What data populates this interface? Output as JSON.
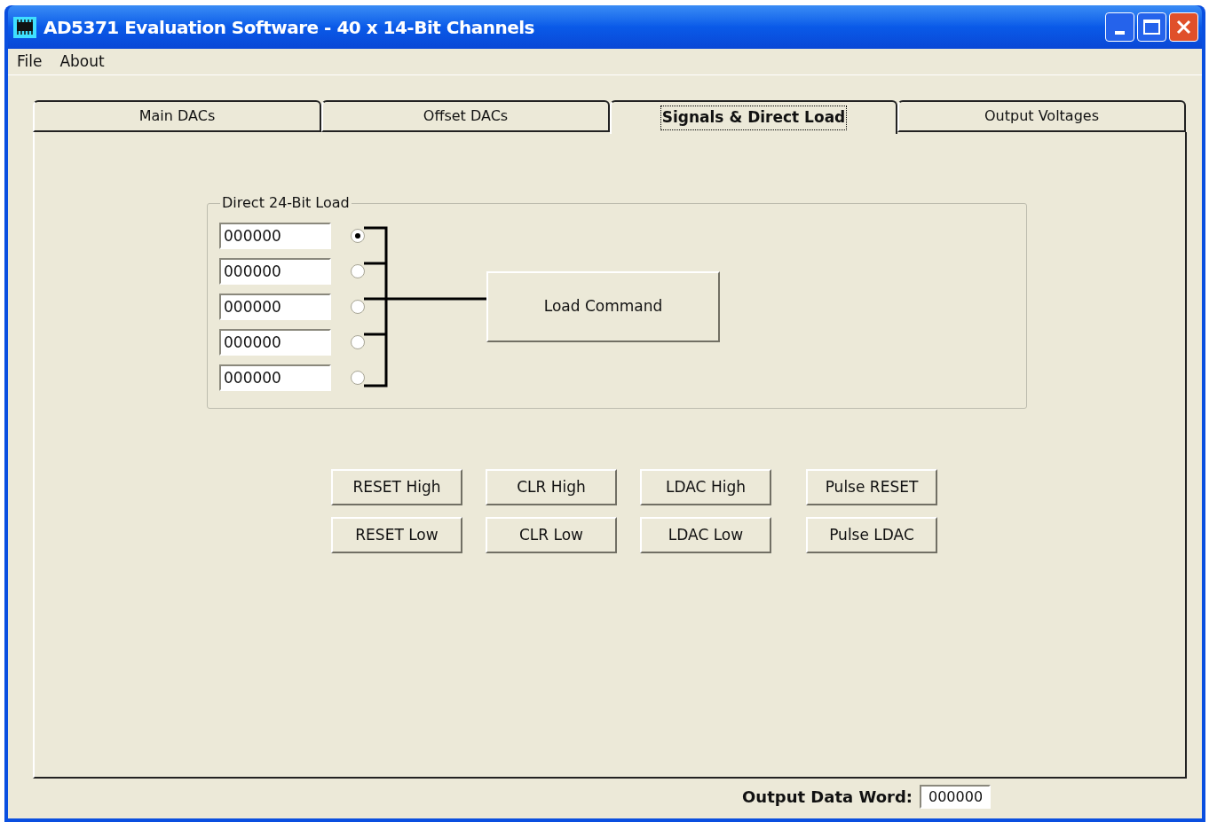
{
  "window": {
    "title": "AD5371 Evaluation Software - 40 x 14-Bit Channels"
  },
  "menu": [
    "File",
    "About"
  ],
  "tabs": [
    {
      "label": "Main DACs",
      "selected": false
    },
    {
      "label": "Offset DACs",
      "selected": false
    },
    {
      "label": "Signals & Direct Load",
      "selected": true
    },
    {
      "label": "Output Voltages",
      "selected": false
    }
  ],
  "direct_load": {
    "title": "Direct 24-Bit Load",
    "rows": [
      {
        "value": "000000",
        "selected": true
      },
      {
        "value": "000000",
        "selected": false
      },
      {
        "value": "000000",
        "selected": false
      },
      {
        "value": "000000",
        "selected": false
      },
      {
        "value": "000000",
        "selected": false
      }
    ],
    "button": "Load Command"
  },
  "signal_buttons": [
    [
      "RESET High",
      "CLR High",
      "LDAC High",
      "Pulse RESET"
    ],
    [
      "RESET Low",
      "CLR Low",
      "LDAC Low",
      "Pulse LDAC"
    ]
  ],
  "output_data_word": {
    "label": "Output Data Word:",
    "value": "000000"
  }
}
